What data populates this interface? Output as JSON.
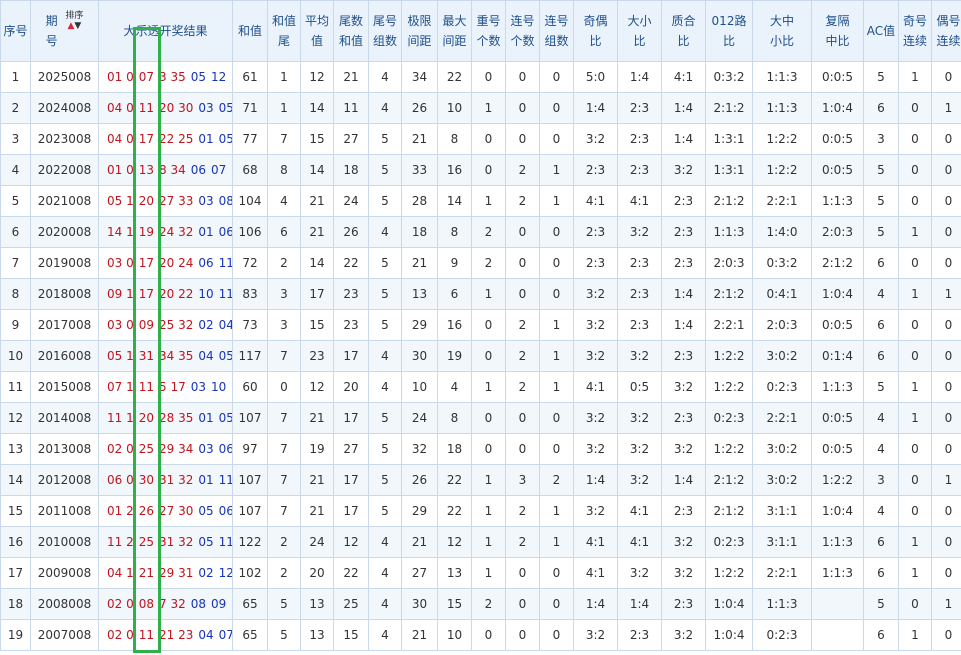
{
  "headers": {
    "seq": "序号",
    "period_top": "期",
    "period_bottom": "号",
    "sort_label": "排序",
    "draw_result": "大乐透开奖结果",
    "sum": "和值",
    "sum_tail_top": "和值",
    "sum_tail_bottom": "尾",
    "avg_top": "平均",
    "avg_bottom": "值",
    "tail_sum_top": "尾数",
    "tail_sum_bottom": "和值",
    "tail_groups_top": "尾号",
    "tail_groups_bottom": "组数",
    "extreme_gap_top": "极限",
    "extreme_gap_bottom": "间距",
    "max_gap_top": "最大",
    "max_gap_bottom": "间距",
    "repeat_top": "重号",
    "repeat_bottom": "个数",
    "consec_count_top": "连号",
    "consec_count_bottom": "个数",
    "consec_group_top": "连号",
    "consec_group_bottom": "组数",
    "odd_even_top": "奇偶",
    "odd_even_bottom": "比",
    "big_small_top": "大小",
    "big_small_bottom": "比",
    "prime_comp_top": "质合",
    "prime_comp_bottom": "比",
    "road012_top": "012路",
    "road012_bottom": "比",
    "big_mid_small_top": "大中",
    "big_mid_small_bottom": "小比",
    "repeat_gap_top": "复隔",
    "repeat_gap_bottom": "中比",
    "ac": "AC值",
    "odd_consec_top": "奇号",
    "odd_consec_bottom": "连续",
    "even_consec_top": "偶号",
    "even_consec_bottom": "连续"
  },
  "rows": [
    {
      "seq": "1",
      "period": "2025008",
      "red": [
        "01 0",
        "07",
        "3 35"
      ],
      "blue": [
        "05",
        "12"
      ],
      "sum": "61",
      "sum_tail": "1",
      "avg": "12",
      "tail_sum": "21",
      "tail_groups": "4",
      "extreme_gap": "34",
      "max_gap": "22",
      "repeat": "0",
      "consec_count": "0",
      "consec_group": "0",
      "odd_even": "5:0",
      "big_small": "1:4",
      "prime_comp": "4:1",
      "road012": "0:3:2",
      "bms": "1:1:3",
      "rep_gap": "0:0:5",
      "ac": "5",
      "odd_c": "1",
      "even_c": "0"
    },
    {
      "seq": "2",
      "period": "2024008",
      "red": [
        "04 0",
        "11",
        "20 30"
      ],
      "blue": [
        "03",
        "05"
      ],
      "sum": "71",
      "sum_tail": "1",
      "avg": "14",
      "tail_sum": "11",
      "tail_groups": "4",
      "extreme_gap": "26",
      "max_gap": "10",
      "repeat": "1",
      "consec_count": "0",
      "consec_group": "0",
      "odd_even": "1:4",
      "big_small": "2:3",
      "prime_comp": "1:4",
      "road012": "2:1:2",
      "bms": "1:1:3",
      "rep_gap": "1:0:4",
      "ac": "6",
      "odd_c": "0",
      "even_c": "1"
    },
    {
      "seq": "3",
      "period": "2023008",
      "red": [
        "04 0",
        "17",
        "22 25"
      ],
      "blue": [
        "01",
        "05"
      ],
      "sum": "77",
      "sum_tail": "7",
      "avg": "15",
      "tail_sum": "27",
      "tail_groups": "5",
      "extreme_gap": "21",
      "max_gap": "8",
      "repeat": "0",
      "consec_count": "0",
      "consec_group": "0",
      "odd_even": "3:2",
      "big_small": "2:3",
      "prime_comp": "1:4",
      "road012": "1:3:1",
      "bms": "1:2:2",
      "rep_gap": "0:0:5",
      "ac": "3",
      "odd_c": "0",
      "even_c": "0"
    },
    {
      "seq": "4",
      "period": "2022008",
      "red": [
        "01 0",
        "13",
        "8 34"
      ],
      "blue": [
        "06",
        "07"
      ],
      "sum": "68",
      "sum_tail": "8",
      "avg": "14",
      "tail_sum": "18",
      "tail_groups": "5",
      "extreme_gap": "33",
      "max_gap": "16",
      "repeat": "0",
      "consec_count": "2",
      "consec_group": "1",
      "odd_even": "2:3",
      "big_small": "2:3",
      "prime_comp": "3:2",
      "road012": "1:3:1",
      "bms": "1:2:2",
      "rep_gap": "0:0:5",
      "ac": "5",
      "odd_c": "0",
      "even_c": "0"
    },
    {
      "seq": "5",
      "period": "2021008",
      "red": [
        "05 1",
        "20",
        "27 33"
      ],
      "blue": [
        "03",
        "08"
      ],
      "sum": "104",
      "sum_tail": "4",
      "avg": "21",
      "tail_sum": "24",
      "tail_groups": "5",
      "extreme_gap": "28",
      "max_gap": "14",
      "repeat": "1",
      "consec_count": "2",
      "consec_group": "1",
      "odd_even": "4:1",
      "big_small": "4:1",
      "prime_comp": "2:3",
      "road012": "2:1:2",
      "bms": "2:2:1",
      "rep_gap": "1:1:3",
      "ac": "5",
      "odd_c": "0",
      "even_c": "0"
    },
    {
      "seq": "6",
      "period": "2020008",
      "red": [
        "14 1",
        "19",
        "24 32"
      ],
      "blue": [
        "01",
        "06"
      ],
      "sum": "106",
      "sum_tail": "6",
      "avg": "21",
      "tail_sum": "26",
      "tail_groups": "4",
      "extreme_gap": "18",
      "max_gap": "8",
      "repeat": "2",
      "consec_count": "0",
      "consec_group": "0",
      "odd_even": "2:3",
      "big_small": "3:2",
      "prime_comp": "2:3",
      "road012": "1:1:3",
      "bms": "1:4:0",
      "rep_gap": "2:0:3",
      "ac": "5",
      "odd_c": "1",
      "even_c": "0"
    },
    {
      "seq": "7",
      "period": "2019008",
      "red": [
        "03 0",
        "17",
        "20 24"
      ],
      "blue": [
        "06",
        "11"
      ],
      "sum": "72",
      "sum_tail": "2",
      "avg": "14",
      "tail_sum": "22",
      "tail_groups": "5",
      "extreme_gap": "21",
      "max_gap": "9",
      "repeat": "2",
      "consec_count": "0",
      "consec_group": "0",
      "odd_even": "2:3",
      "big_small": "2:3",
      "prime_comp": "2:3",
      "road012": "2:0:3",
      "bms": "0:3:2",
      "rep_gap": "2:1:2",
      "ac": "6",
      "odd_c": "0",
      "even_c": "0"
    },
    {
      "seq": "8",
      "period": "2018008",
      "red": [
        "09 1",
        "17",
        "20 22"
      ],
      "blue": [
        "10",
        "11"
      ],
      "sum": "83",
      "sum_tail": "3",
      "avg": "17",
      "tail_sum": "23",
      "tail_groups": "5",
      "extreme_gap": "13",
      "max_gap": "6",
      "repeat": "1",
      "consec_count": "0",
      "consec_group": "0",
      "odd_even": "3:2",
      "big_small": "2:3",
      "prime_comp": "1:4",
      "road012": "2:1:2",
      "bms": "0:4:1",
      "rep_gap": "1:0:4",
      "ac": "4",
      "odd_c": "1",
      "even_c": "1"
    },
    {
      "seq": "9",
      "period": "2017008",
      "red": [
        "03 0",
        "09",
        "25 32"
      ],
      "blue": [
        "02",
        "04"
      ],
      "sum": "73",
      "sum_tail": "3",
      "avg": "15",
      "tail_sum": "23",
      "tail_groups": "5",
      "extreme_gap": "29",
      "max_gap": "16",
      "repeat": "0",
      "consec_count": "2",
      "consec_group": "1",
      "odd_even": "3:2",
      "big_small": "2:3",
      "prime_comp": "1:4",
      "road012": "2:2:1",
      "bms": "2:0:3",
      "rep_gap": "0:0:5",
      "ac": "6",
      "odd_c": "0",
      "even_c": "0"
    },
    {
      "seq": "10",
      "period": "2016008",
      "red": [
        "05 1",
        "31",
        "34 35"
      ],
      "blue": [
        "04",
        "05"
      ],
      "sum": "117",
      "sum_tail": "7",
      "avg": "23",
      "tail_sum": "17",
      "tail_groups": "4",
      "extreme_gap": "30",
      "max_gap": "19",
      "repeat": "0",
      "consec_count": "2",
      "consec_group": "1",
      "odd_even": "3:2",
      "big_small": "3:2",
      "prime_comp": "2:3",
      "road012": "1:2:2",
      "bms": "3:0:2",
      "rep_gap": "0:1:4",
      "ac": "6",
      "odd_c": "0",
      "even_c": "0"
    },
    {
      "seq": "11",
      "period": "2015008",
      "red": [
        "07 1",
        "11",
        "5 17"
      ],
      "blue": [
        "03",
        "10"
      ],
      "sum": "60",
      "sum_tail": "0",
      "avg": "12",
      "tail_sum": "20",
      "tail_groups": "4",
      "extreme_gap": "10",
      "max_gap": "4",
      "repeat": "1",
      "consec_count": "2",
      "consec_group": "1",
      "odd_even": "4:1",
      "big_small": "0:5",
      "prime_comp": "3:2",
      "road012": "1:2:2",
      "bms": "0:2:3",
      "rep_gap": "1:1:3",
      "ac": "5",
      "odd_c": "1",
      "even_c": "0"
    },
    {
      "seq": "12",
      "period": "2014008",
      "red": [
        "11 1",
        "20",
        "28 35"
      ],
      "blue": [
        "01",
        "05"
      ],
      "sum": "107",
      "sum_tail": "7",
      "avg": "21",
      "tail_sum": "17",
      "tail_groups": "5",
      "extreme_gap": "24",
      "max_gap": "8",
      "repeat": "0",
      "consec_count": "0",
      "consec_group": "0",
      "odd_even": "3:2",
      "big_small": "3:2",
      "prime_comp": "2:3",
      "road012": "0:2:3",
      "bms": "2:2:1",
      "rep_gap": "0:0:5",
      "ac": "4",
      "odd_c": "1",
      "even_c": "0"
    },
    {
      "seq": "13",
      "period": "2013008",
      "red": [
        "02 0",
        "25",
        "29 34"
      ],
      "blue": [
        "03",
        "06"
      ],
      "sum": "97",
      "sum_tail": "7",
      "avg": "19",
      "tail_sum": "27",
      "tail_groups": "5",
      "extreme_gap": "32",
      "max_gap": "18",
      "repeat": "0",
      "consec_count": "0",
      "consec_group": "0",
      "odd_even": "3:2",
      "big_small": "3:2",
      "prime_comp": "3:2",
      "road012": "1:2:2",
      "bms": "3:0:2",
      "rep_gap": "0:0:5",
      "ac": "4",
      "odd_c": "0",
      "even_c": "0"
    },
    {
      "seq": "14",
      "period": "2012008",
      "red": [
        "06 0",
        "30",
        "31 32"
      ],
      "blue": [
        "01",
        "11"
      ],
      "sum": "107",
      "sum_tail": "7",
      "avg": "21",
      "tail_sum": "17",
      "tail_groups": "5",
      "extreme_gap": "26",
      "max_gap": "22",
      "repeat": "1",
      "consec_count": "3",
      "consec_group": "2",
      "odd_even": "1:4",
      "big_small": "3:2",
      "prime_comp": "1:4",
      "road012": "2:1:2",
      "bms": "3:0:2",
      "rep_gap": "1:2:2",
      "ac": "3",
      "odd_c": "0",
      "even_c": "1"
    },
    {
      "seq": "15",
      "period": "2011008",
      "red": [
        "01 2",
        "26",
        "27 30"
      ],
      "blue": [
        "05",
        "06"
      ],
      "sum": "107",
      "sum_tail": "7",
      "avg": "21",
      "tail_sum": "17",
      "tail_groups": "5",
      "extreme_gap": "29",
      "max_gap": "22",
      "repeat": "1",
      "consec_count": "2",
      "consec_group": "1",
      "odd_even": "3:2",
      "big_small": "4:1",
      "prime_comp": "2:3",
      "road012": "2:1:2",
      "bms": "3:1:1",
      "rep_gap": "1:0:4",
      "ac": "4",
      "odd_c": "0",
      "even_c": "0"
    },
    {
      "seq": "16",
      "period": "2010008",
      "red": [
        "11 2",
        "25",
        "31 32"
      ],
      "blue": [
        "05",
        "11"
      ],
      "sum": "122",
      "sum_tail": "2",
      "avg": "24",
      "tail_sum": "12",
      "tail_groups": "4",
      "extreme_gap": "21",
      "max_gap": "12",
      "repeat": "1",
      "consec_count": "2",
      "consec_group": "1",
      "odd_even": "4:1",
      "big_small": "4:1",
      "prime_comp": "3:2",
      "road012": "0:2:3",
      "bms": "3:1:1",
      "rep_gap": "1:1:3",
      "ac": "6",
      "odd_c": "1",
      "even_c": "0"
    },
    {
      "seq": "17",
      "period": "2009008",
      "red": [
        "04 1",
        "21",
        "29 31"
      ],
      "blue": [
        "02",
        "12"
      ],
      "sum": "102",
      "sum_tail": "2",
      "avg": "20",
      "tail_sum": "22",
      "tail_groups": "4",
      "extreme_gap": "27",
      "max_gap": "13",
      "repeat": "1",
      "consec_count": "0",
      "consec_group": "0",
      "odd_even": "4:1",
      "big_small": "3:2",
      "prime_comp": "3:2",
      "road012": "1:2:2",
      "bms": "2:2:1",
      "rep_gap": "1:1:3",
      "ac": "6",
      "odd_c": "1",
      "even_c": "0"
    },
    {
      "seq": "18",
      "period": "2008008",
      "red": [
        "02 0",
        "08",
        "7 32"
      ],
      "blue": [
        "08",
        "09"
      ],
      "sum": "65",
      "sum_tail": "5",
      "avg": "13",
      "tail_sum": "25",
      "tail_groups": "4",
      "extreme_gap": "30",
      "max_gap": "15",
      "repeat": "2",
      "consec_count": "0",
      "consec_group": "0",
      "odd_even": "1:4",
      "big_small": "1:4",
      "prime_comp": "2:3",
      "road012": "1:0:4",
      "bms": "1:1:3",
      "rep_gap": "",
      "ac": "5",
      "odd_c": "0",
      "even_c": "1"
    },
    {
      "seq": "19",
      "period": "2007008",
      "red": [
        "02 0",
        "11",
        "21 23"
      ],
      "blue": [
        "04",
        "07"
      ],
      "sum": "65",
      "sum_tail": "5",
      "avg": "13",
      "tail_sum": "15",
      "tail_groups": "4",
      "extreme_gap": "21",
      "max_gap": "10",
      "repeat": "0",
      "consec_count": "0",
      "consec_group": "0",
      "odd_even": "3:2",
      "big_small": "2:3",
      "prime_comp": "3:2",
      "road012": "1:0:4",
      "bms": "0:2:3",
      "rep_gap": "",
      "ac": "6",
      "odd_c": "1",
      "even_c": "0"
    }
  ],
  "colors": {
    "header_bg": "#eaf3fc",
    "border": "#c9d9ea",
    "red_ball": "#c0141e",
    "blue_ball": "#1634b8",
    "highlight": "#2fb14a"
  }
}
